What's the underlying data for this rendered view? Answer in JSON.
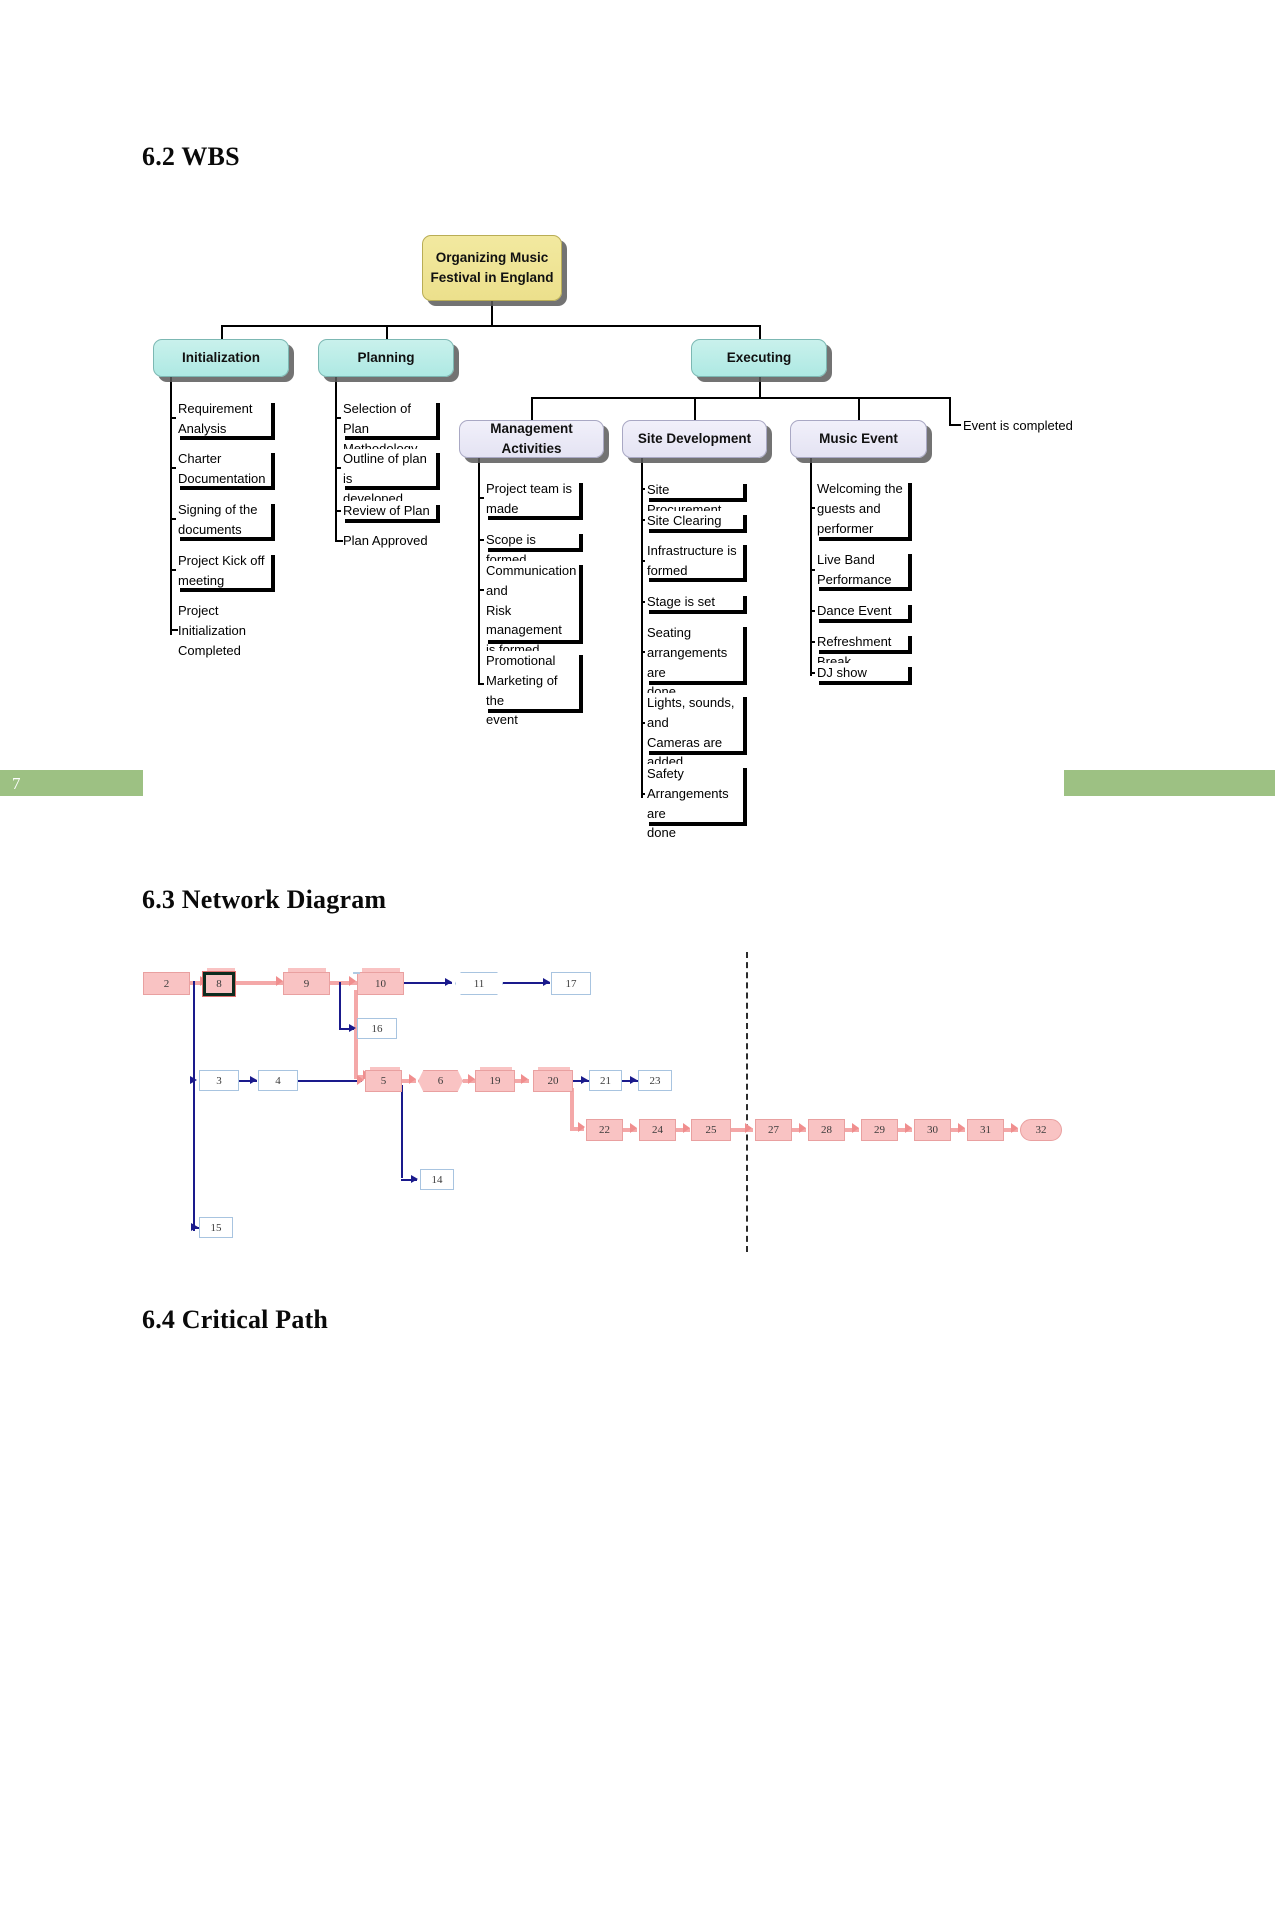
{
  "document": {
    "page_number": "7",
    "headings": {
      "wbs": "6.2 WBS",
      "network": "6.3 Network Diagram",
      "critical": "6.4 Critical Path"
    }
  },
  "wbs": {
    "root": "Organizing Music\nFestival in England",
    "phases": [
      {
        "label": "Initialization"
      },
      {
        "label": "Planning"
      },
      {
        "label": "Executing"
      }
    ],
    "initialization_tasks": [
      "Requirement\nAnalysis",
      "Charter\nDocumentation",
      "Signing of the\ndocuments",
      "Project Kick off\nmeeting",
      "Project Initialization\nCompleted"
    ],
    "planning_tasks": [
      "Selection of Plan\nMethodology",
      "Outline of plan is\ndeveloped",
      "Review of Plan",
      "Plan Approved"
    ],
    "executing_children": [
      {
        "label": "Management Activities"
      },
      {
        "label": "Site Development"
      },
      {
        "label": "Music Event"
      }
    ],
    "executing_leaf": "Event is completed",
    "management_tasks": [
      "Project team is\nmade",
      "Scope is formed",
      "Communication and\nRisk management\nis formed",
      "Promotional\nMarketing of the\nevent"
    ],
    "site_development_tasks": [
      "Site Procurement",
      "Site Clearing",
      "Infrastructure is\nformed",
      "Stage is set",
      "Seating\narrangements are\ndone",
      "Lights, sounds, and\nCameras are added",
      "Safety\nArrangements are\ndone"
    ],
    "music_event_tasks": [
      "Welcoming the\nguests and\nperformer",
      "Live Band\nPerformance",
      "Dance Event",
      "Refreshment Break",
      "DJ show"
    ],
    "colors": {
      "root_fill": "#ece08c",
      "phase_fill": "#aee9e3",
      "sub_fill": "#e4e3f3",
      "shadow": "#5a5a5a"
    }
  },
  "network": {
    "row_top": [
      "2",
      "8",
      "9",
      "10",
      "11",
      "17"
    ],
    "row_top_branch": [
      "16"
    ],
    "row_middle": [
      "3",
      "4",
      "5",
      "6",
      "19",
      "20",
      "21",
      "23"
    ],
    "row_middle_branch": [
      "14"
    ],
    "row_far_branch": [
      "15"
    ],
    "row_bottom": [
      "22",
      "24",
      "25",
      "27",
      "28",
      "29",
      "30",
      "31",
      "32"
    ],
    "selected_node": "8",
    "colors": {
      "critical_fill": "#f9c3c3",
      "critical_border": "#e9a0a0",
      "normal_border": "#a8c4e0",
      "critical_arrow": "#f08e8e",
      "normal_arrow": "#1a1a8c"
    }
  }
}
